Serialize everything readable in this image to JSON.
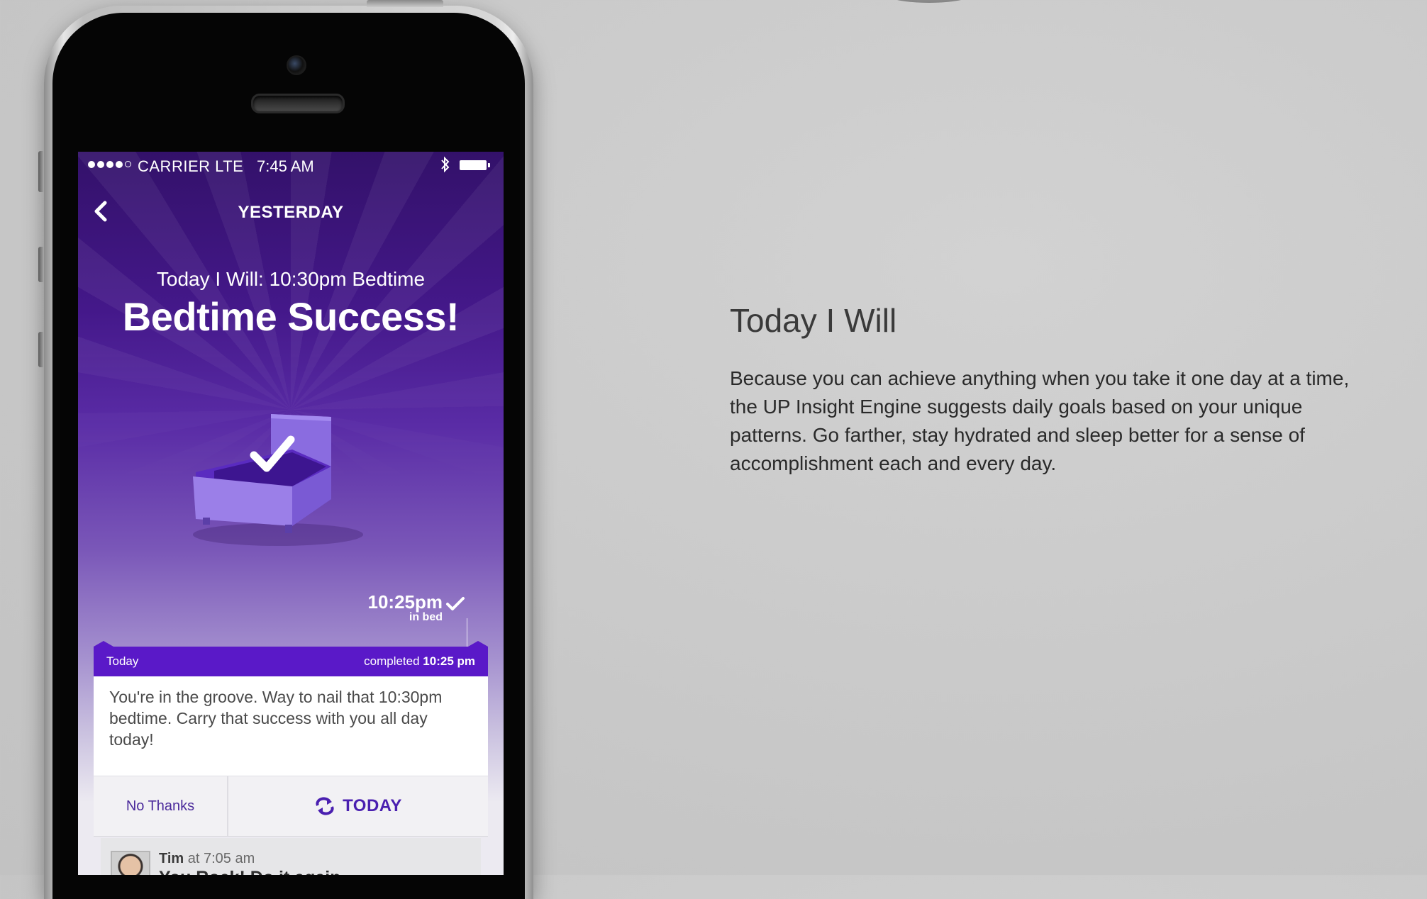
{
  "status_bar": {
    "carrier": "CARRIER LTE",
    "time": "7:45 AM",
    "signal_bars": 4,
    "signal_max": 5,
    "icons": [
      "bluetooth-icon",
      "battery-icon"
    ]
  },
  "nav": {
    "title": "YESTERDAY",
    "back_icon": "chevron-left-icon"
  },
  "goal": {
    "subtitle": "Today I Will: 10:30pm Bedtime",
    "title": "Bedtime Success!",
    "illustration": "bed-checkmark-icon"
  },
  "bedtime_marker": {
    "time": "10:25pm",
    "label": "in bed"
  },
  "card": {
    "header_left": "Today",
    "header_right_prefix": "completed",
    "header_right_time": "10:25 pm",
    "body": "You're in the groove. Way to nail that 10:30pm bedtime. Carry that success with you all day today!",
    "actions": {
      "no_thanks": "No Thanks",
      "today": "TODAY",
      "today_icon": "repeat-icon"
    }
  },
  "comment": {
    "author": "Tim",
    "at": "at 7:05 am",
    "text": "You Rock!  Do it again"
  },
  "section": {
    "heading": "Today I Will",
    "body": "Because you can achieve anything when you take it one day at a time, the UP Insight Engine suggests daily goals based on your unique patterns. Go farther, stay hydrated and sleep better for a sense of accomplishment each and every day."
  },
  "colors": {
    "accent_purple": "#5a19c8",
    "screen_top": "#33116a",
    "background": "#cbcbcb"
  }
}
